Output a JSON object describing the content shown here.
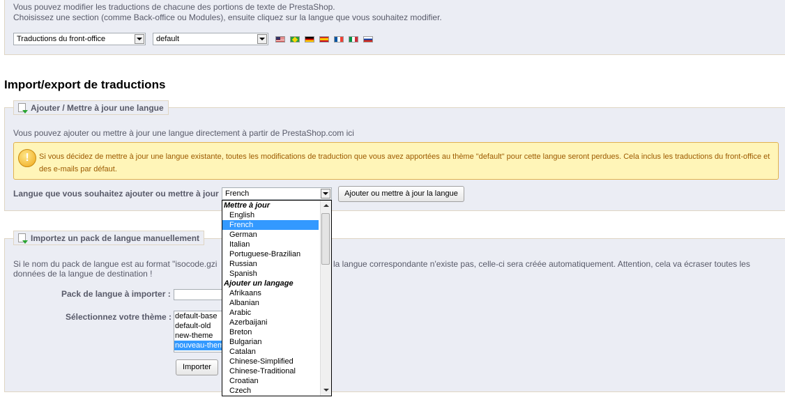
{
  "top": {
    "intro_line1": "Vous pouvez modifier les traductions de chacune des portions de texte de PrestaShop.",
    "intro_line2": "Choisissez une section (comme Back-office ou Modules), ensuite cliquez sur la langue que vous souhaitez modifier.",
    "section_select_value": "Traductions du front-office",
    "theme_select_value": "default",
    "flags": [
      {
        "icon": "flag-us-icon"
      },
      {
        "icon": "flag-br-icon"
      },
      {
        "icon": "flag-de-icon"
      },
      {
        "icon": "flag-es-icon"
      },
      {
        "icon": "flag-fr-icon"
      },
      {
        "icon": "flag-it-icon"
      },
      {
        "icon": "flag-ru-icon"
      }
    ]
  },
  "import_export": {
    "heading": "Import/export de traductions"
  },
  "add_update": {
    "legend": "Ajouter / Mettre à jour une langue",
    "description": "Vous pouvez ajouter ou mettre à jour une langue directement à partir de PrestaShop.com ici",
    "warning_line1": "Si vous décidez de mettre à jour une langue existante, toutes les modifications de traduction que vous avez apportées au thème \"default\" pour cette langue seront perdues. Cela inclus les traductions du front-office et",
    "warning_line2": "des e-mails par défaut.",
    "language_label": "Langue que vous souhaitez ajouter ou mettre à jour :",
    "language_select_value": "French",
    "submit_label": "Ajouter ou mettre à jour la langue"
  },
  "dropdown": {
    "group_update": "Mettre à jour",
    "update_options": [
      "English",
      "French",
      "German",
      "Italian",
      "Portuguese-Brazilian",
      "Russian",
      "Spanish"
    ],
    "selected": "French",
    "group_add": "Ajouter un langage",
    "add_options": [
      "Afrikaans",
      "Albanian",
      "Arabic",
      "Azerbaijani",
      "Breton",
      "Bulgarian",
      "Catalan",
      "Chinese-Simplified",
      "Chinese-Traditional",
      "Croatian",
      "Czech"
    ]
  },
  "manual_import": {
    "legend": "Importez un pack de langue manuellement",
    "desc_left_line1": "Si le nom du pack de langue est au format \"isocode.gzi",
    "desc_right_line1": "la langue correspondante n'existe pas, celle-ci sera créée automatiquement. Attention, cela va écraser toutes les",
    "desc_line2": "données de la langue de destination !",
    "pack_label": "Pack de langue à importer :",
    "theme_label": "Sélectionnez votre thème :",
    "themes": [
      "default-base",
      "default-old",
      "new-theme",
      "nouveau-them"
    ],
    "selected_theme": "nouveau-them",
    "import_button": "Importer"
  }
}
